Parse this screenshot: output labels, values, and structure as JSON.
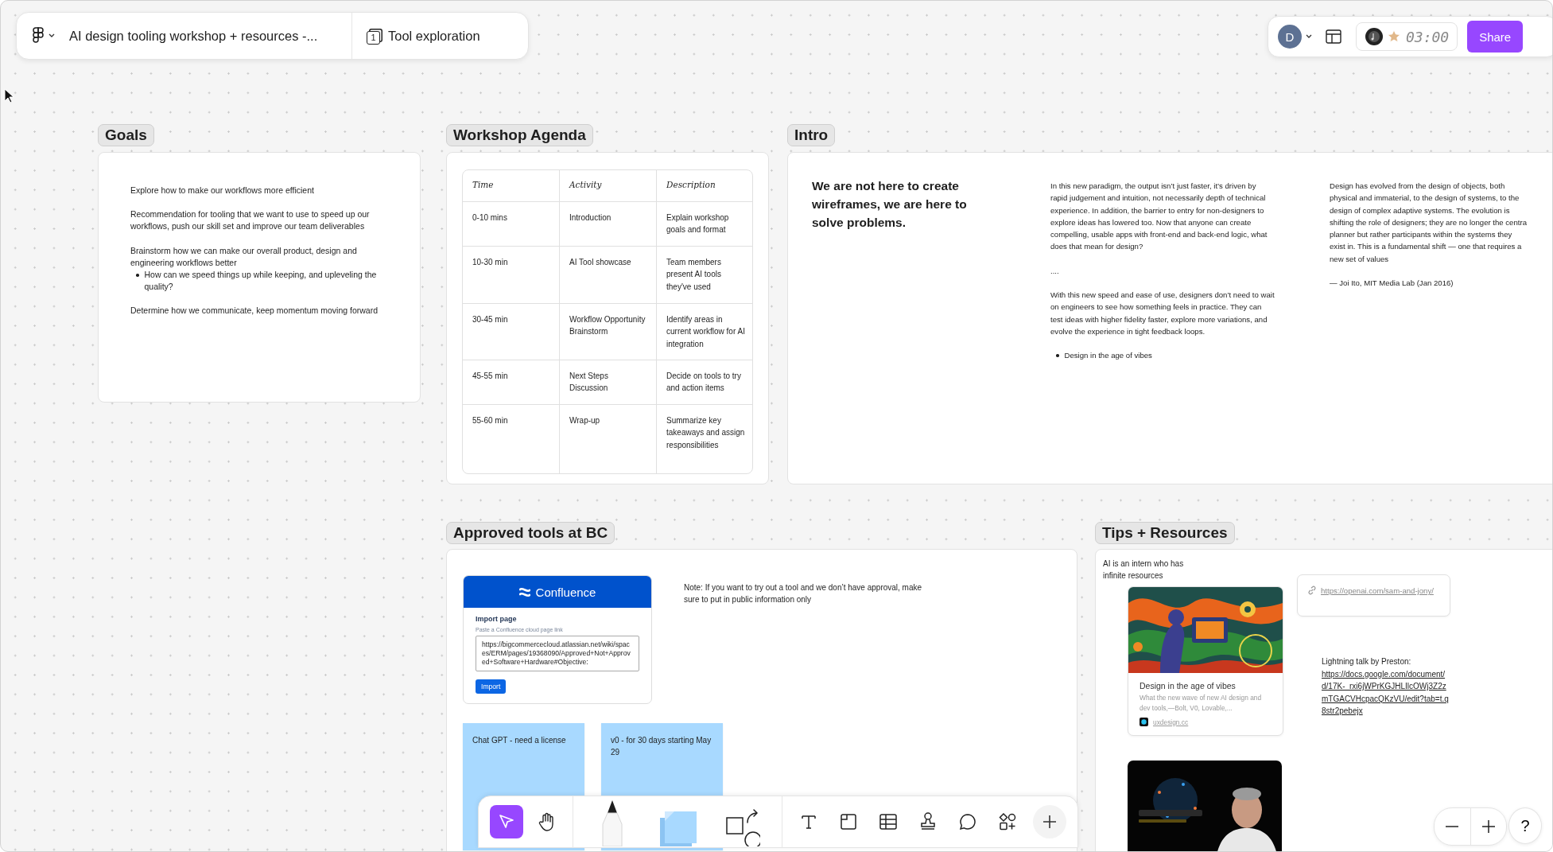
{
  "top_bar": {
    "file_title": "AI design tooling workshop + resources -...",
    "page_count": "1",
    "page_name": "Tool exploration"
  },
  "header_actions": {
    "avatar": "D",
    "timer": "03:00",
    "share": "Share"
  },
  "goals": {
    "title": "Goals",
    "blocks": [
      {
        "kind": "paragraph",
        "text": "Explore how to make our workflows more efficient"
      },
      {
        "kind": "paragraph",
        "text": "Recommendation for tooling that we want to use to speed up our workflows, push our skill set and improve our team deliverables"
      },
      {
        "kind": "paragraph",
        "text": "Brainstorm how we can make our overall product, design and engineering workflows better"
      },
      {
        "kind": "bullet",
        "text": "How can we speed things up while keeping, and upleveling the quality?"
      },
      {
        "kind": "paragraph",
        "text": "Determine how we communicate, keep momentum moving forward"
      }
    ]
  },
  "agenda": {
    "title": "Workshop Agenda",
    "columns": [
      "Time",
      "Activity",
      "Description"
    ],
    "rows": [
      [
        "0-10 mins",
        "Introduction",
        "Explain workshop goals and format"
      ],
      [
        "10-30 min",
        "AI Tool showcase",
        "Team members present AI tools they've used"
      ],
      [
        "30-45 min",
        "Workflow Opportunity Brainstorm",
        "Identify areas in current workflow for AI integration"
      ],
      [
        "45-55 min",
        "Next Steps Discussion",
        "Decide on tools to try and action items"
      ],
      [
        "55-60 min",
        "Wrap-up",
        "Summarize key takeaways and assign responsibilities"
      ]
    ]
  },
  "intro": {
    "title": "Intro",
    "headline": "We are not here to create wireframes, we are here to solve problems.",
    "columns": [
      {
        "blocks": [
          {
            "kind": "paragraph",
            "text": "In this new paradigm, the output isn’t just faster, it’s driven by rapid judgement and intuition, not necessarily depth of technical experience. In addition, the barrier to entry for non-designers to explore ideas has lowered too. Now that anyone can create compelling, usable apps with front-end and back-end logic, what does that mean for design?"
          },
          {
            "kind": "paragraph",
            "text": "...."
          },
          {
            "kind": "paragraph",
            "text": "With this new speed and ease of use, designers don’t need to wait on engineers to see how something feels in practice. They can test ideas with higher fidelity faster, explore more variations, and evolve the experience in tight feedback loops."
          },
          {
            "kind": "bullet",
            "text": "Design in the age of vibes"
          }
        ]
      },
      {
        "blocks": [
          {
            "kind": "lines",
            "lines": [
              "Design has evolved from the design of objects, both",
              "physical and immaterial, to the design of systems, to the",
              "design of complex adaptive systems. The evolution is",
              "shifting the role of designers; they are no longer the centra",
              "planner but rather participants within the systems they",
              "exist in. This is a fundamental shift — one that requires a",
              "new set of values"
            ]
          },
          {
            "kind": "paragraph",
            "text": "— Joi Ito, MIT Media Lab (Jan 2016)"
          }
        ]
      }
    ]
  },
  "approved_tools": {
    "title": "Approved tools at BC",
    "confluence": {
      "name": "Confluence",
      "heading": "Import page",
      "hint": "Paste a Confluence cloud page link",
      "value": "https://bigcommercecloud.atlassian.net/wiki/spaces/ERM/pages/19368090/Approved+Not+Approved+Software+Hardware#Objective:",
      "button": "Import"
    },
    "note": "Note: If you want to try out a tool and we don’t have approval, make sure to put in public information only",
    "stickies": [
      {
        "text": "Chat GPT - need a license"
      },
      {
        "text": "v0 - for 30 days starting May 29"
      }
    ]
  },
  "tips": {
    "title": "Tips + Resources",
    "note": "AI is an intern who has infinite resources",
    "article": {
      "title": "Design in the age of vibes",
      "description": "What the new wave of new AI design and dev tools,—Bolt, V0, Lovable,...",
      "source": "uxdesign.cc"
    },
    "link_card": {
      "url": "https://openai.com/sam-and-jony/"
    },
    "lightning": {
      "label": "Lightning talk by Preston:",
      "url": "https://docs.google.com/document/d/17K-_rxi6jWPrKGJHLIlcOWj3Z2zmTGACVHcpacQKzVU/edit?tab=t.q8str2pebejx"
    }
  },
  "toolbar": {
    "tools": [
      {
        "kind": "select",
        "selected": true
      },
      {
        "kind": "hand",
        "selected": false
      },
      {
        "kind": "pen",
        "selected": false
      },
      {
        "kind": "sticky",
        "selected": false
      },
      {
        "kind": "shapes",
        "selected": false
      },
      {
        "kind": "text",
        "selected": false
      },
      {
        "kind": "section",
        "selected": false
      },
      {
        "kind": "table",
        "selected": false
      },
      {
        "kind": "stamp",
        "selected": false
      },
      {
        "kind": "comment",
        "selected": false
      },
      {
        "kind": "more",
        "selected": false
      },
      {
        "kind": "add",
        "selected": false
      }
    ]
  },
  "zoom_controls": {
    "help": "?"
  }
}
